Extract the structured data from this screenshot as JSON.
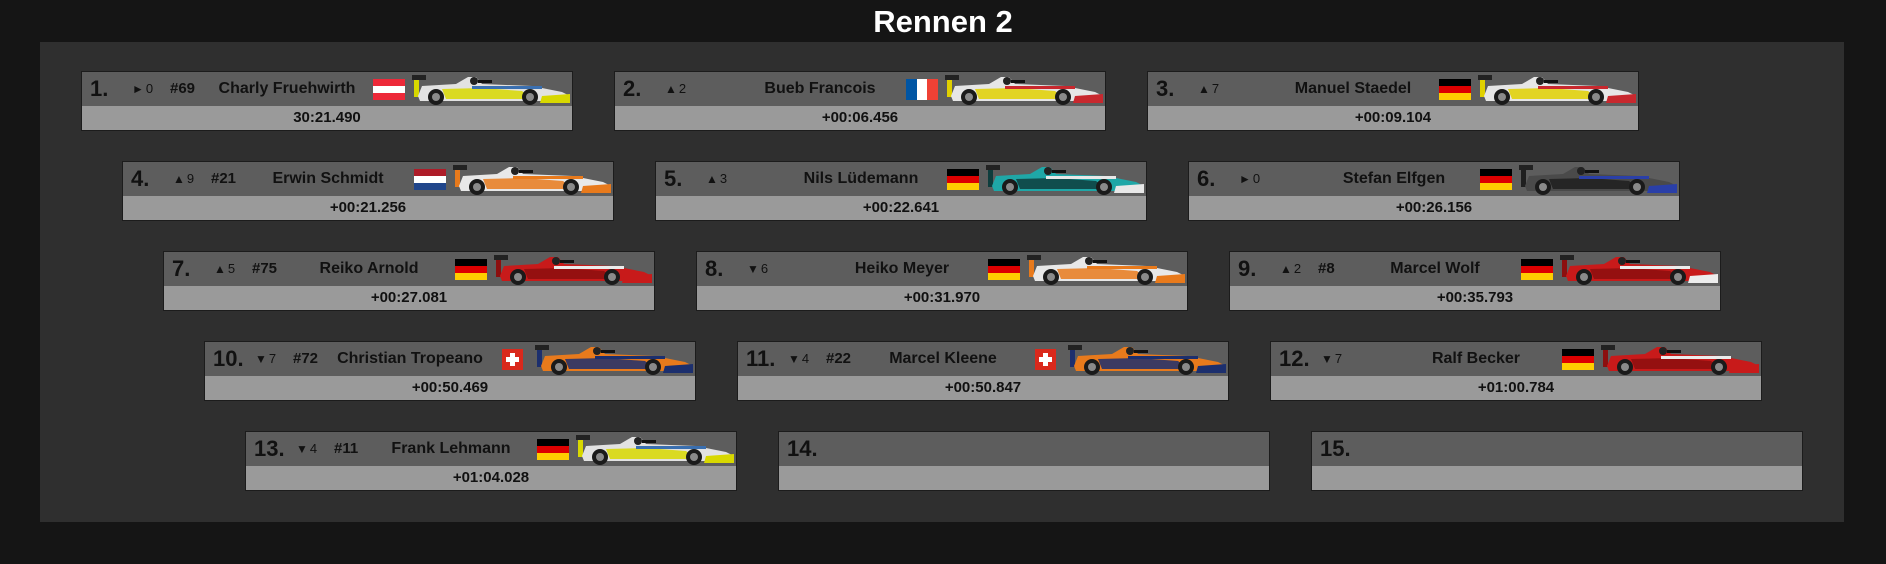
{
  "title": "Rennen 2",
  "entries": [
    {
      "pos": "1.",
      "arrow": "►",
      "change": "0",
      "number": "#69",
      "name": "Charly Fruehwirth",
      "flag": "austria",
      "time": "30:21.490",
      "car": {
        "body": "#e2e2e2",
        "accent": "#d8d800",
        "stripe": "#3a6fb0",
        "nose": "#d8d800"
      }
    },
    {
      "pos": "2.",
      "arrow": "▲",
      "change": "2",
      "number": "",
      "name": "Bueb Francois",
      "flag": "france",
      "time": "+00:06.456",
      "car": {
        "body": "#e6e6e6",
        "accent": "#e0d000",
        "stripe": "#c8282e",
        "nose": "#c8282e"
      }
    },
    {
      "pos": "3.",
      "arrow": "▲",
      "change": "7",
      "number": "",
      "name": "Manuel Staedel",
      "flag": "germany",
      "time": "+00:09.104",
      "car": {
        "body": "#e6e6e6",
        "accent": "#e0d000",
        "stripe": "#c8282e",
        "nose": "#c8282e"
      }
    },
    {
      "pos": "4.",
      "arrow": "▲",
      "change": "9",
      "number": "#21",
      "name": "Erwin Schmidt",
      "flag": "netherlands",
      "time": "+00:21.256",
      "car": {
        "body": "#e8e8e8",
        "accent": "#e87a1c",
        "stripe": "#e87a1c",
        "nose": "#e87a1c"
      }
    },
    {
      "pos": "5.",
      "arrow": "▲",
      "change": "3",
      "number": "",
      "name": "Nils Lüdemann",
      "flag": "germany",
      "time": "+00:22.641",
      "car": {
        "body": "#1fa7a7",
        "accent": "#0e3d3d",
        "stripe": "#e8e8e8",
        "nose": "#e8e8e8"
      }
    },
    {
      "pos": "6.",
      "arrow": "►",
      "change": "0",
      "number": "",
      "name": "Stefan Elfgen",
      "flag": "germany",
      "time": "+00:26.156",
      "car": {
        "body": "#4a4a4a",
        "accent": "#1f1f1f",
        "stripe": "#2a3fa8",
        "nose": "#2a3fa8"
      }
    },
    {
      "pos": "7.",
      "arrow": "▲",
      "change": "5",
      "number": "#75",
      "name": "Reiko Arnold",
      "flag": "germany",
      "time": "+00:27.081",
      "car": {
        "body": "#c81a1a",
        "accent": "#8c0f0f",
        "stripe": "#ececec",
        "nose": "#c81a1a"
      }
    },
    {
      "pos": "8.",
      "arrow": "▼",
      "change": "6",
      "number": "",
      "name": "Heiko Meyer",
      "flag": "germany",
      "time": "+00:31.970",
      "car": {
        "body": "#e8e8e8",
        "accent": "#e87a1c",
        "stripe": "#e87a1c",
        "nose": "#e87a1c"
      }
    },
    {
      "pos": "9.",
      "arrow": "▲",
      "change": "2",
      "number": "#8",
      "name": "Marcel Wolf",
      "flag": "germany",
      "time": "+00:35.793",
      "car": {
        "body": "#c81a1a",
        "accent": "#8c0f0f",
        "stripe": "#ececec",
        "nose": "#ececec"
      }
    },
    {
      "pos": "10.",
      "arrow": "▼",
      "change": "7",
      "number": "#72",
      "name": "Christian Tropeano",
      "flag": "switzerland",
      "time": "+00:50.469",
      "car": {
        "body": "#e87a1c",
        "accent": "#1c2f6e",
        "stripe": "#1c2f6e",
        "nose": "#1c2f6e"
      }
    },
    {
      "pos": "11.",
      "arrow": "▼",
      "change": "4",
      "number": "#22",
      "name": "Marcel Kleene",
      "flag": "switzerland",
      "time": "+00:50.847",
      "car": {
        "body": "#e87a1c",
        "accent": "#1c2f6e",
        "stripe": "#1c2f6e",
        "nose": "#1c2f6e"
      }
    },
    {
      "pos": "12.",
      "arrow": "▼",
      "change": "7",
      "number": "",
      "name": "Ralf Becker",
      "flag": "germany",
      "time": "+01:00.784",
      "car": {
        "body": "#c81a1a",
        "accent": "#8c0f0f",
        "stripe": "#ececec",
        "nose": "#c81a1a"
      }
    },
    {
      "pos": "13.",
      "arrow": "▼",
      "change": "4",
      "number": "#11",
      "name": "Frank Lehmann",
      "flag": "germany",
      "time": "+01:04.028",
      "car": {
        "body": "#e2e2e2",
        "accent": "#d8d800",
        "stripe": "#3a6fb0",
        "nose": "#d8d800"
      }
    },
    {
      "pos": "14.",
      "arrow": "",
      "change": "",
      "number": "",
      "name": "",
      "flag": "",
      "time": "",
      "car": null
    },
    {
      "pos": "15.",
      "arrow": "",
      "change": "",
      "number": "",
      "name": "",
      "flag": "",
      "time": "",
      "car": null
    }
  ]
}
